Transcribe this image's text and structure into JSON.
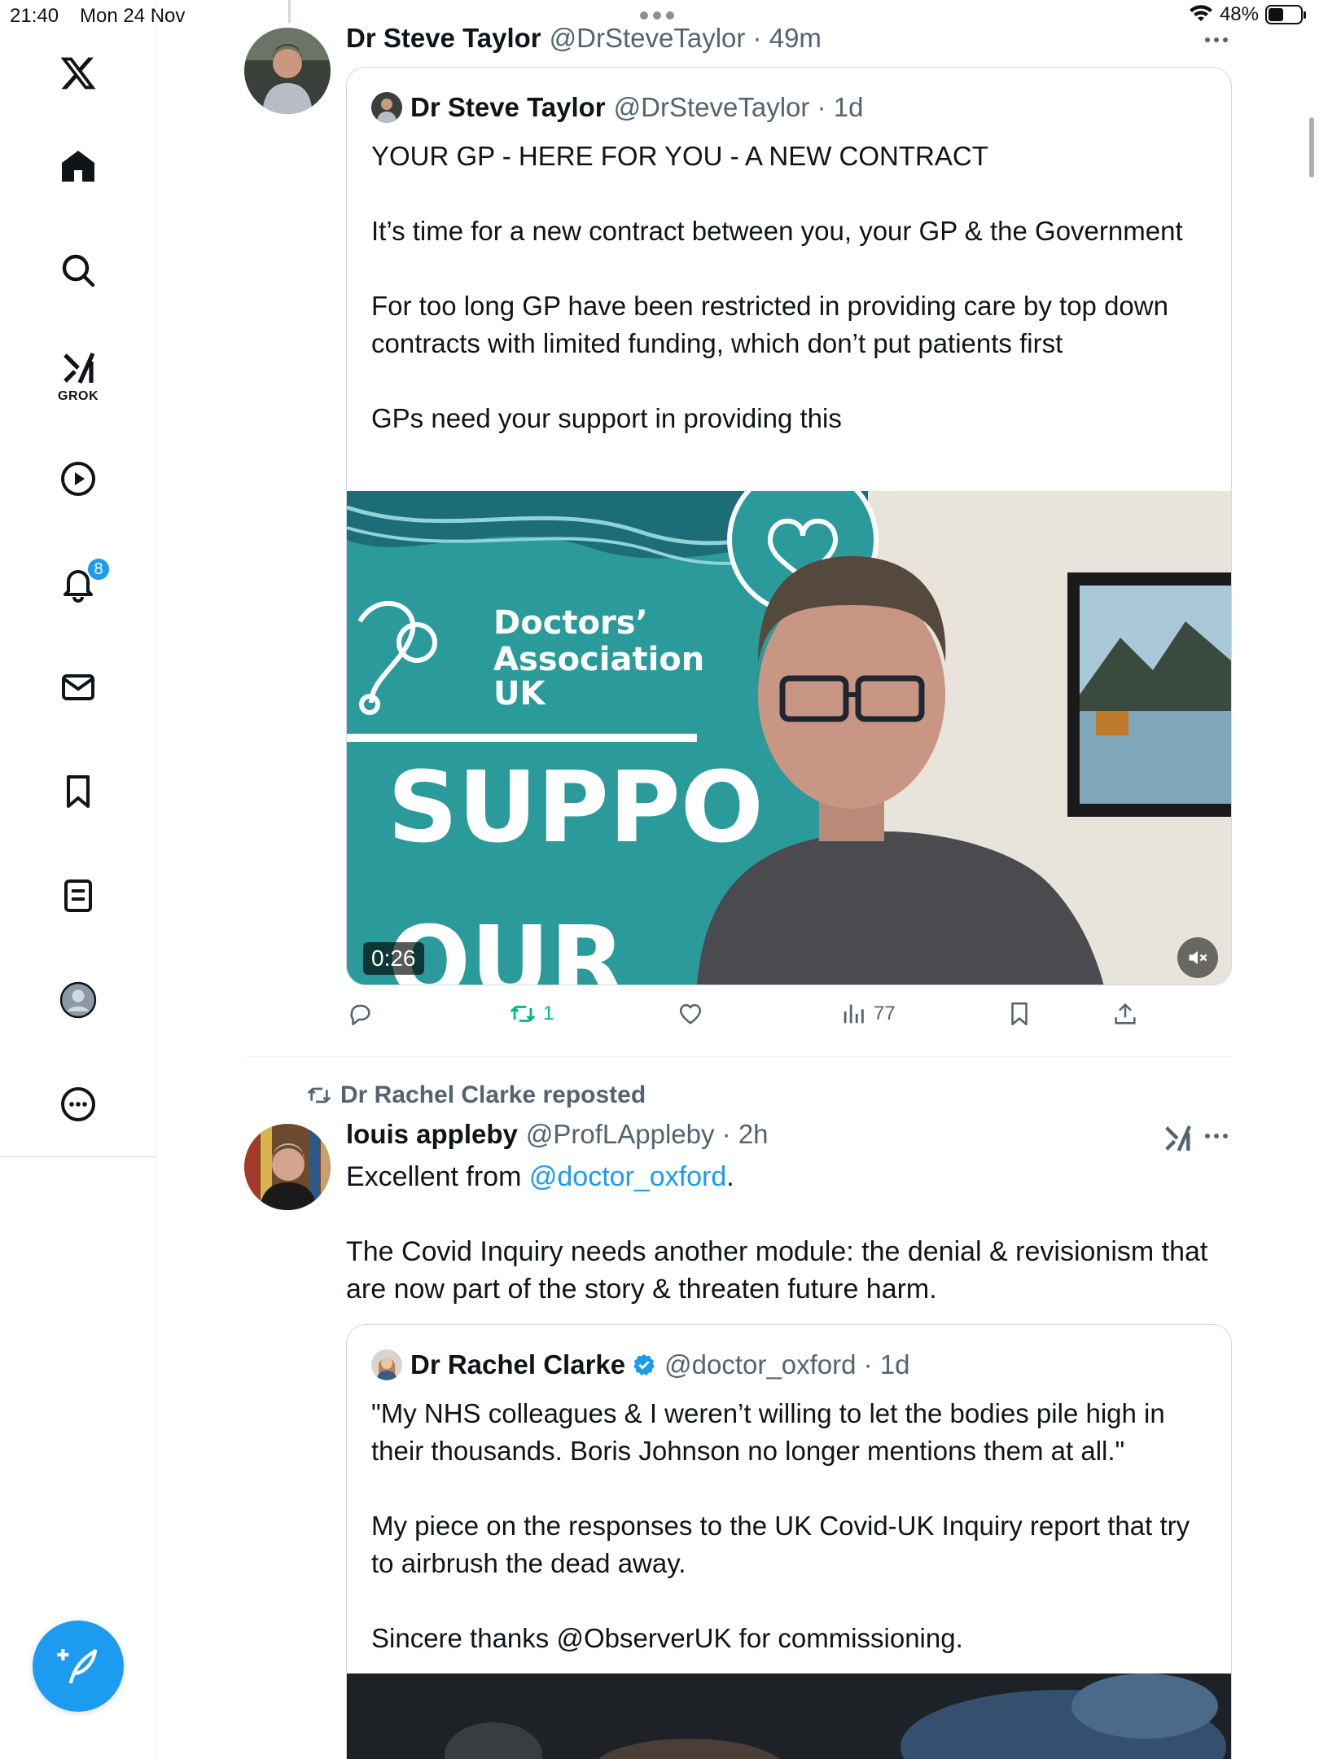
{
  "status_bar": {
    "time": "21:40",
    "date": "Mon 24 Nov",
    "battery": "48%",
    "battery_level": 0.48
  },
  "sidebar": {
    "items": [
      {
        "name": "home",
        "icon": "home-icon"
      },
      {
        "name": "explore",
        "icon": "search-icon"
      },
      {
        "name": "grok",
        "icon": "grok-icon",
        "label": "GROK"
      },
      {
        "name": "video",
        "icon": "play-icon"
      },
      {
        "name": "notifications",
        "icon": "bell-icon",
        "badge": "8"
      },
      {
        "name": "messages",
        "icon": "mail-icon"
      },
      {
        "name": "bookmarks",
        "icon": "bookmark-icon"
      },
      {
        "name": "lists",
        "icon": "list-icon"
      },
      {
        "name": "profile",
        "icon": "profile-icon"
      },
      {
        "name": "more",
        "icon": "more-circle-icon"
      }
    ],
    "compose_icon": "compose-icon"
  },
  "tweet1": {
    "name": "Dr Steve Taylor",
    "handle": "@DrSteveTaylor · 49m",
    "quoted": {
      "name": "Dr Steve Taylor",
      "handle": "@DrSteveTaylor · 1d",
      "text": "YOUR GP - HERE FOR YOU - A NEW CONTRACT\n\nIt’s time for a new contract between you, your GP & the Government\n\nFor too long GP have been restricted in providing care by top down contracts with limited funding, which don’t put patients first\n\nGPs need your support in providing this",
      "video": {
        "duration": "0:26",
        "banner_org_line1": "Doctors’",
        "banner_org_line2": "Association",
        "banner_org_line3": "UK",
        "banner_big1": "SUPPO",
        "banner_big2": "OUR"
      }
    },
    "actions": {
      "reposts": "1",
      "views": "77"
    }
  },
  "tweet2": {
    "repost_by": "Dr Rachel Clarke reposted",
    "name": "louis appleby",
    "handle": "@ProfLAppleby · 2h",
    "text_before_mention": "Excellent from ",
    "mention": "@doctor_oxford",
    "text_after_mention": ".",
    "text_body": "The Covid Inquiry needs another module: the denial & revisionism that are now part of the story & threaten future harm.",
    "quoted": {
      "name": "Dr Rachel Clarke",
      "handle": "@doctor_oxford · 1d",
      "text": "\"My NHS colleagues & I weren’t willing to let the bodies pile high in their thousands. Boris Johnson no longer mentions them at all.\"\n\nMy piece on the responses to the UK Covid-UK Inquiry report that try to airbrush the dead away.\n\nSincere thanks @ObserverUK for commissioning."
    }
  },
  "colors": {
    "accent": "#1d9bf0",
    "repost_green": "#00ba7c",
    "text_secondary": "#536471"
  }
}
